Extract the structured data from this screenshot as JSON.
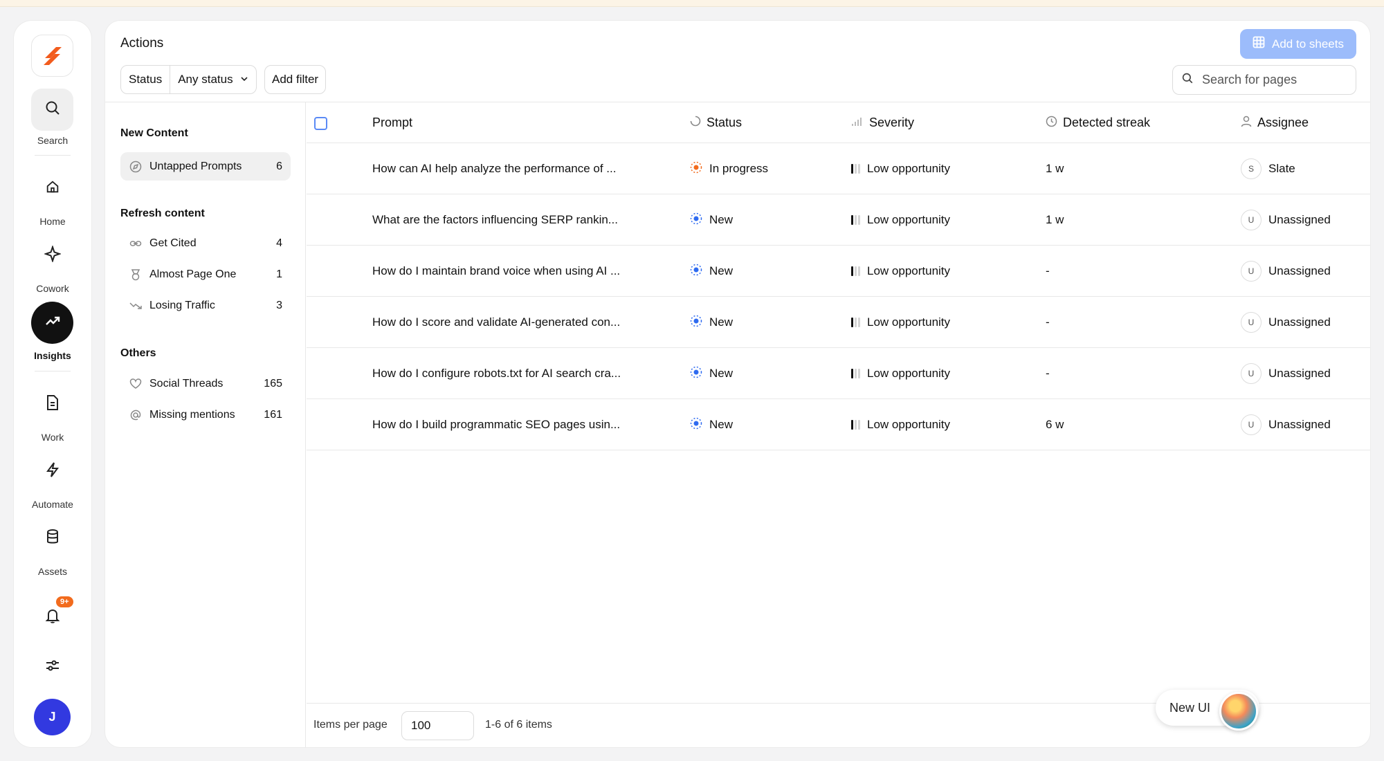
{
  "rail": {
    "items": [
      {
        "label": "Search",
        "icon": "search-icon"
      },
      {
        "label": "Home",
        "icon": "home-icon"
      },
      {
        "label": "Cowork",
        "icon": "sparkle-icon"
      },
      {
        "label": "Insights",
        "icon": "trending-up-icon"
      },
      {
        "label": "Work",
        "icon": "document-icon"
      },
      {
        "label": "Automate",
        "icon": "bolt-icon"
      },
      {
        "label": "Assets",
        "icon": "database-icon"
      }
    ],
    "notification_badge": "9+",
    "avatar_initial": "J"
  },
  "header": {
    "title": "Actions",
    "add_to_sheets": "Add to sheets",
    "filter_label": "Status",
    "filter_value": "Any status",
    "add_filter": "Add filter",
    "search_placeholder": "Search for pages"
  },
  "sidebar": {
    "sections": [
      {
        "title": "New Content",
        "items": [
          {
            "label": "Untapped Prompts",
            "count": "6",
            "selected": true
          }
        ]
      },
      {
        "title": "Refresh content",
        "items": [
          {
            "label": "Get Cited",
            "count": "4"
          },
          {
            "label": "Almost Page One",
            "count": "1"
          },
          {
            "label": "Losing Traffic",
            "count": "3"
          }
        ]
      },
      {
        "title": "Others",
        "items": [
          {
            "label": "Social Threads",
            "count": "165"
          },
          {
            "label": "Missing mentions",
            "count": "161"
          }
        ]
      }
    ]
  },
  "table": {
    "columns": [
      "Prompt",
      "Status",
      "Severity",
      "Detected streak",
      "Assignee"
    ],
    "rows": [
      {
        "prompt": "How can AI help analyze the performance of ...",
        "status": "In progress",
        "severity": "Low opportunity",
        "streak": "1 w",
        "assignee_initial": "S",
        "assignee": "Slate"
      },
      {
        "prompt": "What are the factors influencing SERP rankin...",
        "status": "New",
        "severity": "Low opportunity",
        "streak": "1 w",
        "assignee_initial": "U",
        "assignee": "Unassigned"
      },
      {
        "prompt": "How do I maintain brand voice when using AI ...",
        "status": "New",
        "severity": "Low opportunity",
        "streak": "-",
        "assignee_initial": "U",
        "assignee": "Unassigned"
      },
      {
        "prompt": "How do I score and validate AI-generated con...",
        "status": "New",
        "severity": "Low opportunity",
        "streak": "-",
        "assignee_initial": "U",
        "assignee": "Unassigned"
      },
      {
        "prompt": "How do I configure robots.txt for AI search cra...",
        "status": "New",
        "severity": "Low opportunity",
        "streak": "-",
        "assignee_initial": "U",
        "assignee": "Unassigned"
      },
      {
        "prompt": "How do I build programmatic SEO pages usin...",
        "status": "New",
        "severity": "Low opportunity",
        "streak": "6 w",
        "assignee_initial": "U",
        "assignee": "Unassigned"
      }
    ]
  },
  "footer": {
    "items_per_page_label": "Items per page",
    "items_per_page": "100",
    "range": "1-6 of 6 items"
  },
  "new_ui_label": "New UI",
  "colors": {
    "accent": "#3239e0",
    "add_button": "#9cbcfb",
    "in_progress": "#f26b1d",
    "new": "#2f6bf0"
  }
}
